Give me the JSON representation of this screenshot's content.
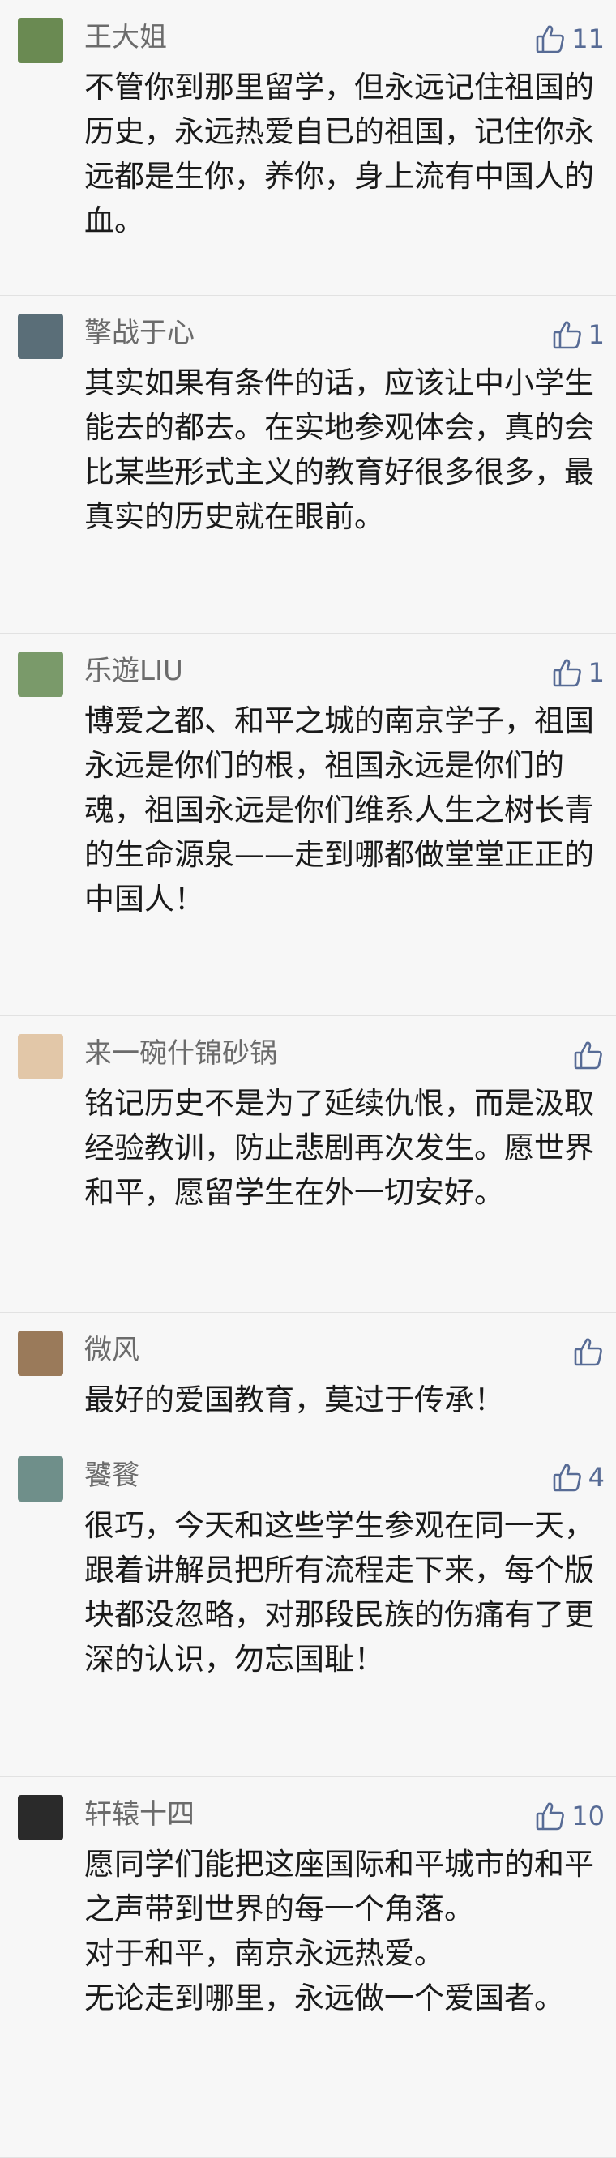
{
  "comments": [
    {
      "author": "王大姐",
      "likes": "11",
      "avatar_icon": "user-avatar-icon",
      "avatar_color": "#6a8a52",
      "text": "不管你到那里留学，但永远记住祖国的历史，永远热爱自已的祖国，记住你永远都是生你，养你，身上流有中国人的血。"
    },
    {
      "author": "擎战于心",
      "likes": "1",
      "avatar_icon": "user-avatar-icon",
      "avatar_color": "#5a6e78",
      "text": "其实如果有条件的话，应该让中小学生能去的都去。在实地参观体会，真的会比某些形式主义的教育好很多很多，最真实的历史就在眼前。"
    },
    {
      "author": "乐遊LIU",
      "likes": "1",
      "avatar_icon": "user-avatar-icon",
      "avatar_color": "#7a9a6a",
      "text": "博爱之都、和平之城的南京学子，祖国永远是你们的根，祖国永远是你们的魂，祖国永远是你们维系人生之树长青的生命源泉——走到哪都做堂堂正正的中国人！"
    },
    {
      "author": "来一碗什锦砂锅",
      "likes": "",
      "avatar_icon": "user-avatar-icon",
      "avatar_color": "#e2c7a8",
      "text": "铭记历史不是为了延续仇恨，而是汲取经验教训，防止悲剧再次发生。愿世界和平，愿留学生在外一切安好。"
    },
    {
      "author": "微风",
      "likes": "",
      "avatar_icon": "user-avatar-icon",
      "avatar_color": "#9a7a5a",
      "text": "最好的爱国教育，莫过于传承！"
    },
    {
      "author": "饕餮",
      "likes": "4",
      "avatar_icon": "user-avatar-icon",
      "avatar_color": "#6f8f8a",
      "text": "很巧，今天和这些学生参观在同一天，跟着讲解员把所有流程走下来，每个版块都没忽略，对那段民族的伤痛有了更深的认识，勿忘国耻！"
    },
    {
      "author": "轩辕十四",
      "likes": "10",
      "avatar_icon": "user-avatar-icon",
      "avatar_color": "#2a2a2a",
      "text": "愿同学们能把这座国际和平城市的和平之声带到世界的每一个角落。\n对于和平，南京永远热爱。\n无论走到哪里，永远做一个爱国者。"
    }
  ]
}
